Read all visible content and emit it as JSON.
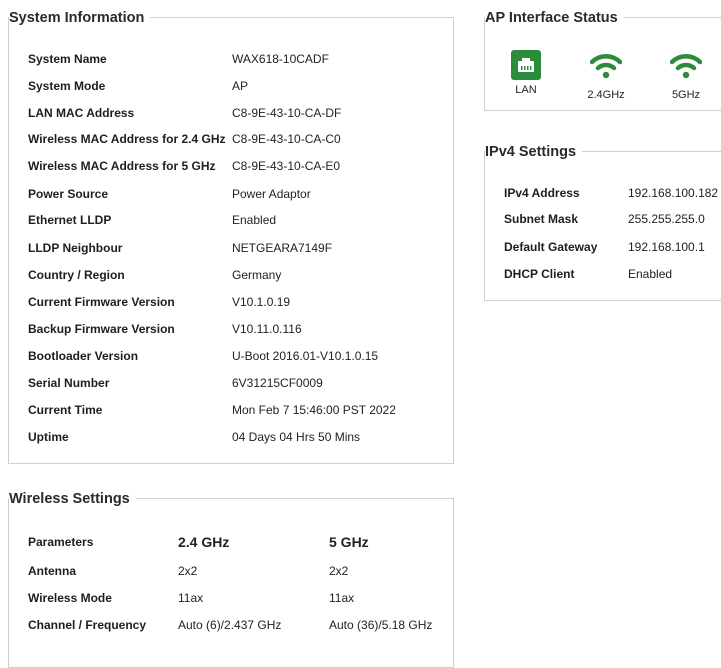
{
  "system_info": {
    "title": "System Information",
    "rows": [
      {
        "label": "System Name",
        "value": "WAX618-10CADF"
      },
      {
        "label": "System Mode",
        "value": "AP"
      },
      {
        "label": "LAN MAC Address",
        "value": "C8-9E-43-10-CA-DF"
      },
      {
        "label": "Wireless MAC Address for 2.4 GHz",
        "value": "C8-9E-43-10-CA-C0"
      },
      {
        "label": "Wireless MAC Address for 5 GHz",
        "value": "C8-9E-43-10-CA-E0"
      },
      {
        "label": "Power Source",
        "value": "Power Adaptor"
      },
      {
        "label": "Ethernet LLDP",
        "value": "Enabled"
      },
      {
        "label": "LLDP Neighbour",
        "value": "NETGEARA7149F"
      },
      {
        "label": "Country / Region",
        "value": "Germany"
      },
      {
        "label": "Current Firmware Version",
        "value": "V10.1.0.19"
      },
      {
        "label": "Backup Firmware Version",
        "value": "V10.11.0.116"
      },
      {
        "label": "Bootloader Version",
        "value": "U-Boot 2016.01-V10.1.0.15"
      },
      {
        "label": "Serial Number",
        "value": "6V31215CF0009"
      },
      {
        "label": "Current Time",
        "value": "Mon Feb 7 15:46:00 PST 2022"
      },
      {
        "label": "Uptime",
        "value": "04 Days 04 Hrs 50 Mins"
      }
    ]
  },
  "ap_interface": {
    "title": "AP Interface Status",
    "items": [
      {
        "label": "LAN",
        "icon": "lan-icon",
        "color": "#2d8c3c"
      },
      {
        "label": "2.4GHz",
        "icon": "wifi-icon",
        "color": "#2d8c3c"
      },
      {
        "label": "5GHz",
        "icon": "wifi-icon",
        "color": "#2d8c3c"
      }
    ]
  },
  "ipv4": {
    "title": "IPv4 Settings",
    "rows": [
      {
        "label": "IPv4 Address",
        "value": "192.168.100.182"
      },
      {
        "label": "Subnet Mask",
        "value": "255.255.255.0"
      },
      {
        "label": "Default Gateway",
        "value": "192.168.100.1"
      },
      {
        "label": "DHCP Client",
        "value": "Enabled"
      }
    ]
  },
  "wireless": {
    "title": "Wireless Settings",
    "headers": {
      "param": "Parameters",
      "band1": "2.4 GHz",
      "band2": "5 GHz"
    },
    "rows": [
      {
        "label": "Antenna",
        "band1": "2x2",
        "band2": "2x2"
      },
      {
        "label": "Wireless Mode",
        "band1": "11ax",
        "band2": "11ax"
      },
      {
        "label": "Channel / Frequency",
        "band1": "Auto (6)/2.437 GHz",
        "band2": "Auto (36)/5.18 GHz"
      }
    ]
  }
}
